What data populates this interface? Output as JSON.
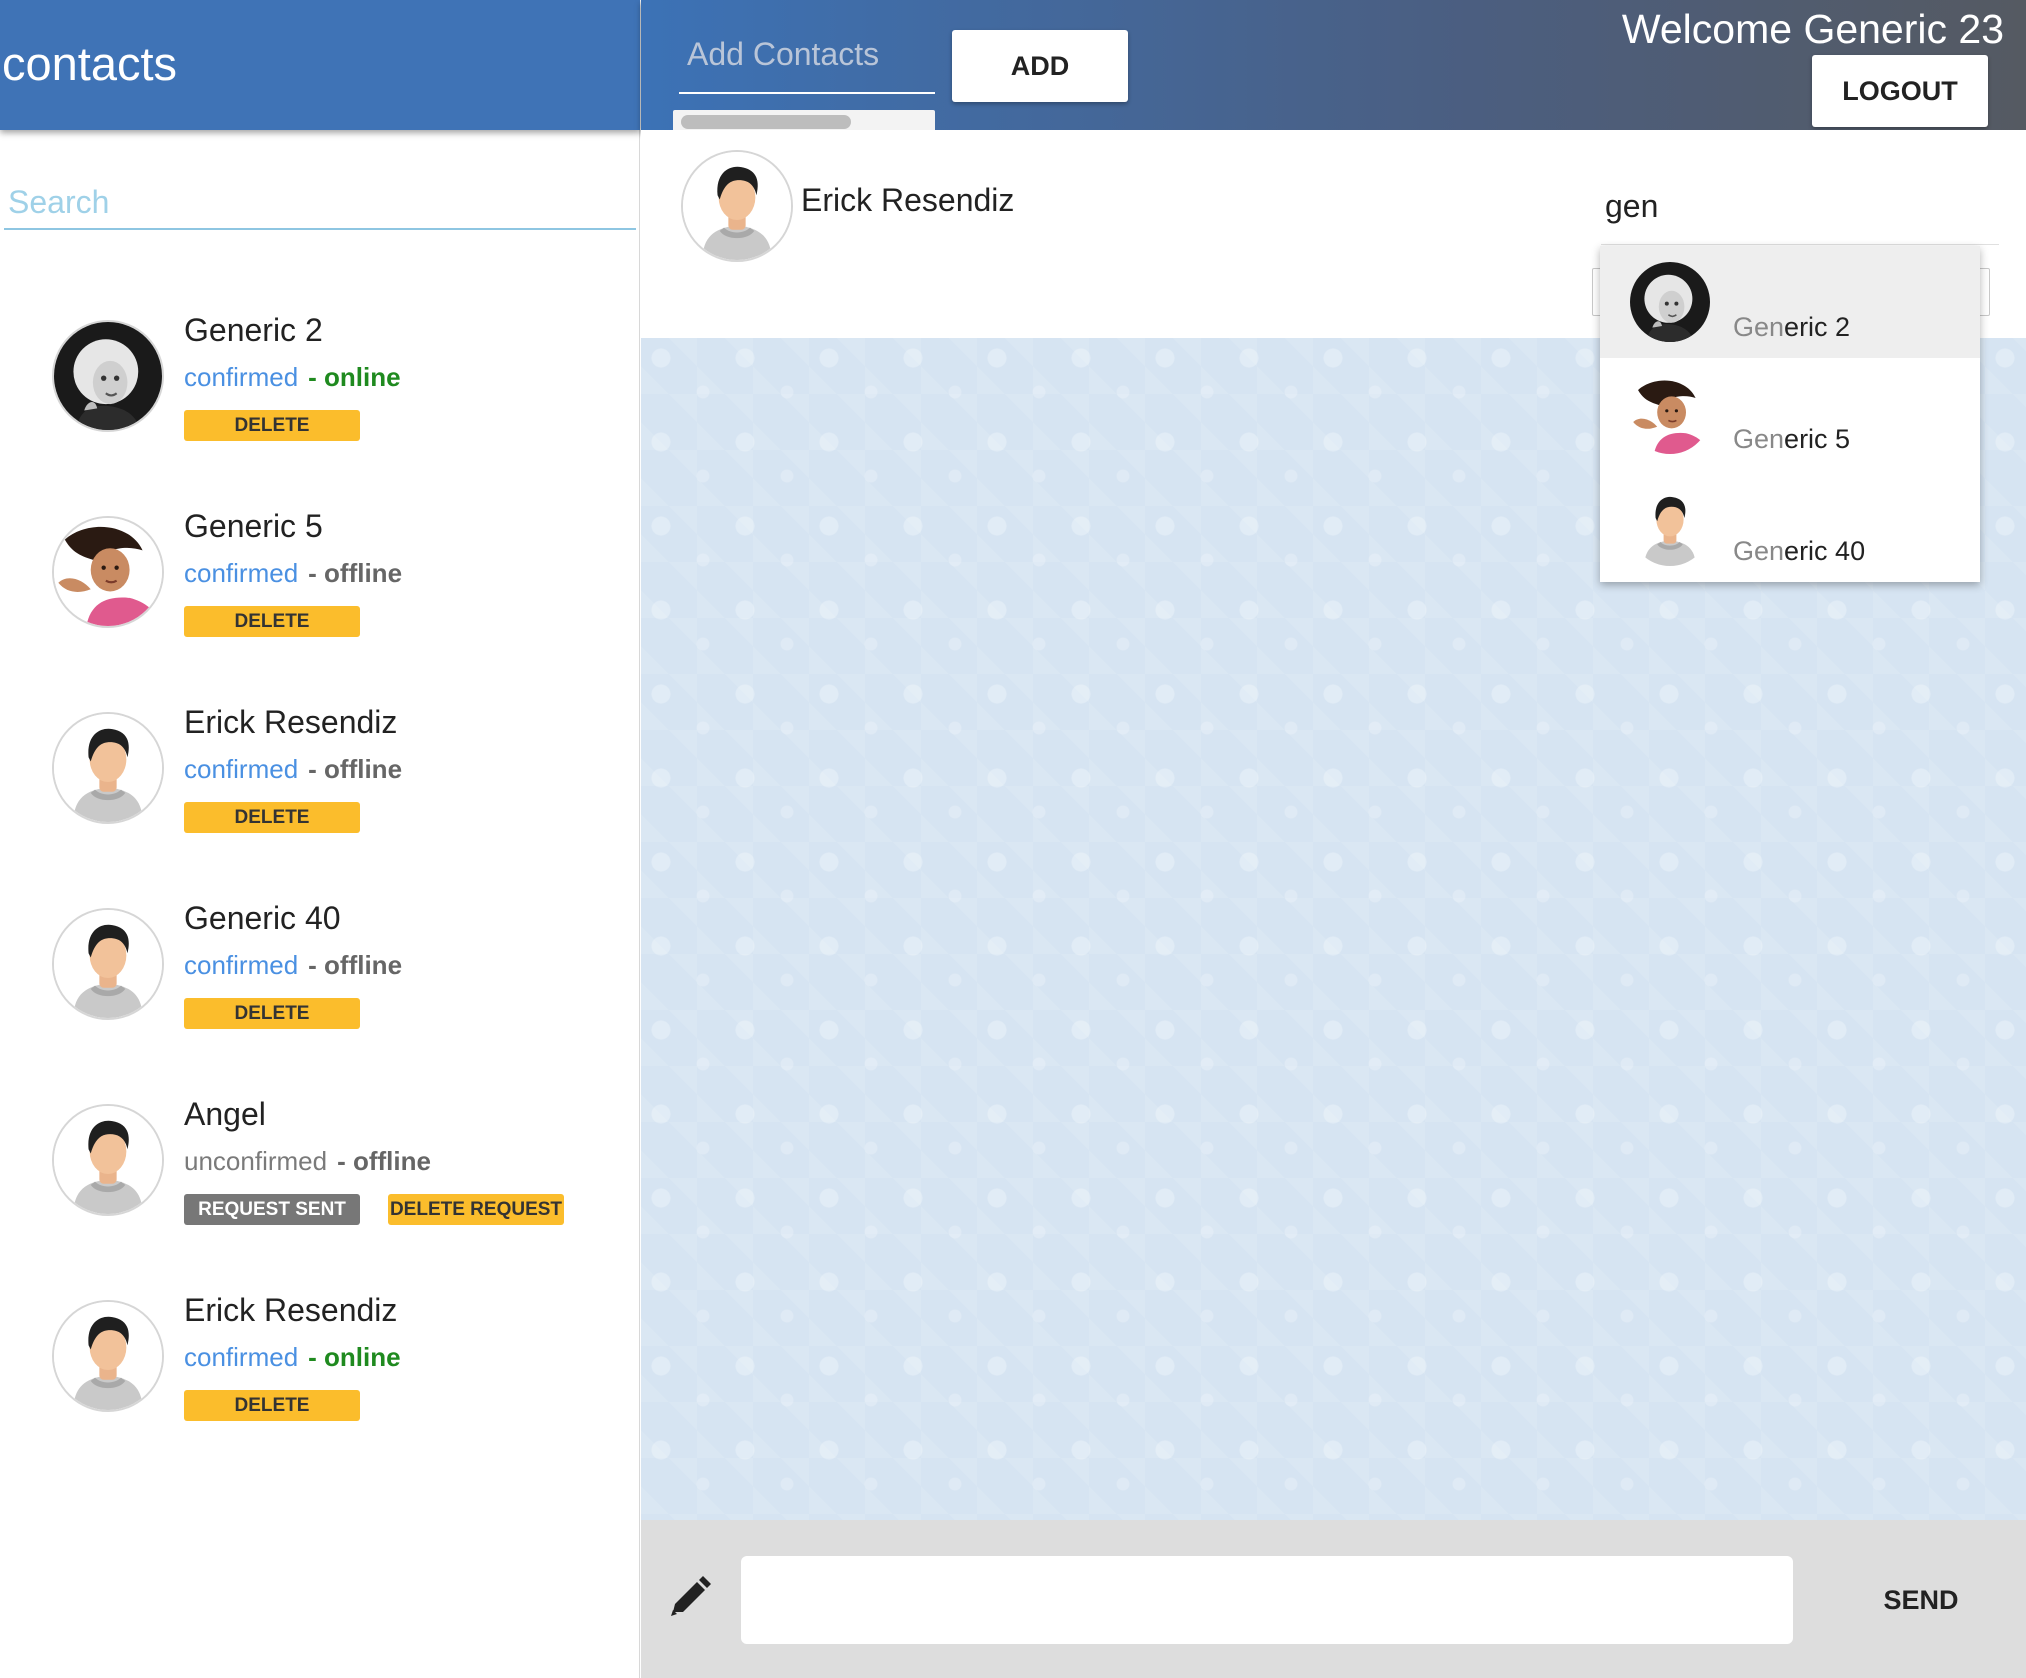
{
  "left_panel": {
    "title": "contacts",
    "search_placeholder": "Search",
    "contacts": [
      {
        "name": "Generic 2",
        "status": "confirmed",
        "presence": "- online",
        "action": "DELETE",
        "avatar": "woman-bw-photo"
      },
      {
        "name": "Generic 5",
        "status": "confirmed",
        "presence": "- offline",
        "action": "DELETE",
        "avatar": "woman-pink-photo"
      },
      {
        "name": "Erick Resendiz",
        "status": "confirmed",
        "presence": "- offline",
        "action": "DELETE",
        "avatar": "default-user"
      },
      {
        "name": "Generic 40",
        "status": "confirmed",
        "presence": "- offline",
        "action": "DELETE",
        "avatar": "default-user"
      },
      {
        "name": "Angel",
        "status": "unconfirmed",
        "presence": "- offline",
        "action": "REQUEST SENT",
        "secondary_action": "DELETE REQUEST",
        "avatar": "default-user"
      },
      {
        "name": "Erick Resendiz",
        "status": "confirmed",
        "presence": "- online",
        "action": "DELETE",
        "avatar": "default-user"
      }
    ]
  },
  "top_bar": {
    "add_contacts_placeholder": "Add Contacts",
    "add_button": "ADD",
    "welcome": "Welcome Generic 23",
    "logout_button": "LOGOUT"
  },
  "chat": {
    "active_contact": "Erick Resendiz",
    "active_avatar": "default-user",
    "search_query": "gen",
    "compose_value": "",
    "send_button": "SEND"
  },
  "autocomplete": {
    "items": [
      {
        "match": "Gen",
        "rest": "eric 2",
        "avatar": "woman-bw-photo",
        "highlighted": true
      },
      {
        "match": "Gen",
        "rest": "eric 5",
        "avatar": "woman-pink-photo",
        "highlighted": false
      },
      {
        "match": "Gen",
        "rest": "eric 40",
        "avatar": "default-user",
        "highlighted": false
      }
    ]
  },
  "colors": {
    "header_blue": "#3f73b6",
    "confirmed_blue": "#4a90e2",
    "online_green": "#1f8a1f",
    "delete_yellow": "#fbbd2c",
    "request_gray": "#777777",
    "chat_background": "#d6e4f2"
  },
  "icons": [
    "pencil-icon",
    "default-user-avatar",
    "woman-bw-photo",
    "woman-pink-photo"
  ]
}
